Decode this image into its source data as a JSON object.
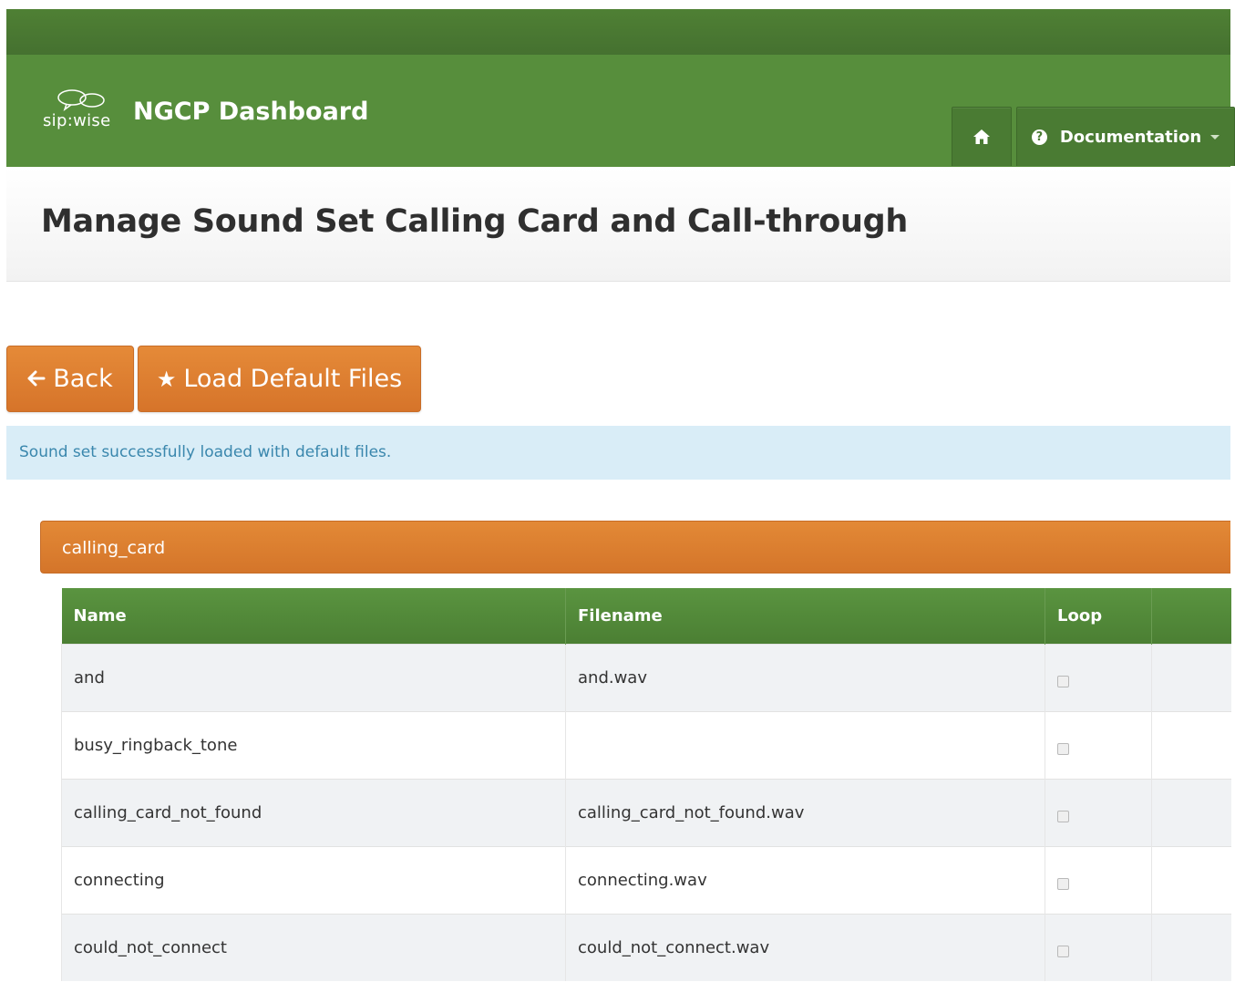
{
  "brand": {
    "logo_text": "sip:wise",
    "title": "NGCP Dashboard"
  },
  "nav": {
    "home_icon": "home-icon",
    "documentation_label": "Documentation"
  },
  "page": {
    "title": "Manage Sound Set Calling Card and Call-through"
  },
  "actions": {
    "back_label": "Back",
    "load_default_label": "Load Default Files"
  },
  "alert": {
    "message": "Sound set successfully loaded with default files."
  },
  "panel": {
    "title": "calling_card"
  },
  "table": {
    "columns": [
      "Name",
      "Filename",
      "Loop",
      ""
    ],
    "rows": [
      {
        "name": "and",
        "filename": "and.wav",
        "loop": false
      },
      {
        "name": "busy_ringback_tone",
        "filename": "",
        "loop": false
      },
      {
        "name": "calling_card_not_found",
        "filename": "calling_card_not_found.wav",
        "loop": false
      },
      {
        "name": "connecting",
        "filename": "connecting.wav",
        "loop": false
      },
      {
        "name": "could_not_connect",
        "filename": "could_not_connect.wav",
        "loop": false
      }
    ]
  },
  "colors": {
    "brand_green": "#578e3c",
    "accent_orange": "#e0822f",
    "info_bg": "#d9edf7"
  }
}
